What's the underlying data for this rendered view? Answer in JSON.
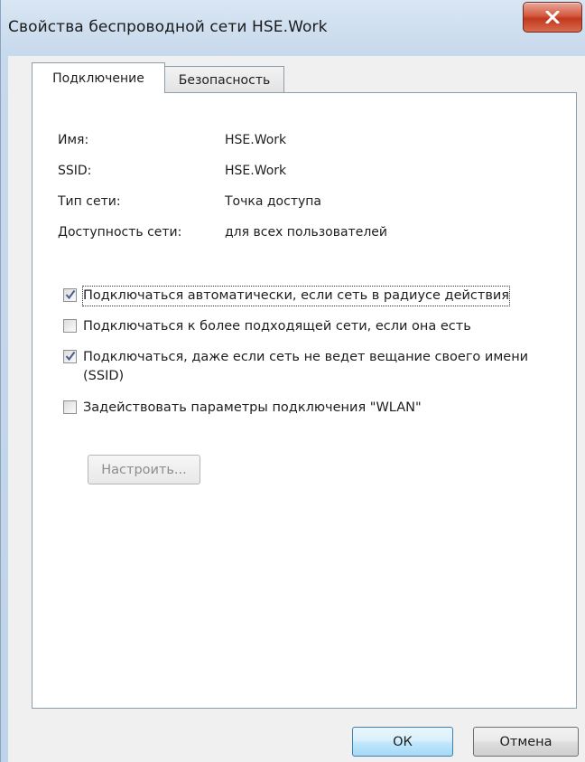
{
  "window": {
    "title": "Свойства беспроводной сети HSE.Work"
  },
  "tabs": [
    {
      "label": "Подключение",
      "active": true
    },
    {
      "label": "Безопасность",
      "active": false
    }
  ],
  "info": {
    "name_label": "Имя:",
    "name_value": "HSE.Work",
    "ssid_label": "SSID:",
    "ssid_value": "HSE.Work",
    "type_label": "Тип сети:",
    "type_value": "Точка доступа",
    "availability_label": "Доступность сети:",
    "availability_value": "для всех пользователей"
  },
  "options": [
    {
      "label": "Подключаться автоматически, если сеть в радиусе действия",
      "checked": true
    },
    {
      "label": "Подключаться к более подходящей сети, если она есть",
      "checked": false
    },
    {
      "label": "Подключаться, даже если сеть не ведет вещание своего имени (SSID)",
      "checked": true
    },
    {
      "label": "Задействовать параметры подключения \"WLAN\"",
      "checked": false
    }
  ],
  "setup_button": "Настроить...",
  "buttons": {
    "ok": "ОК",
    "cancel": "Отмена"
  },
  "colors": {
    "client_bg": "#f0f0f0",
    "ok_border": "#3c7fb1",
    "close_red": "#c1391f"
  },
  "icons": {
    "close": "close-x-icon",
    "check": "checkmark-icon"
  }
}
